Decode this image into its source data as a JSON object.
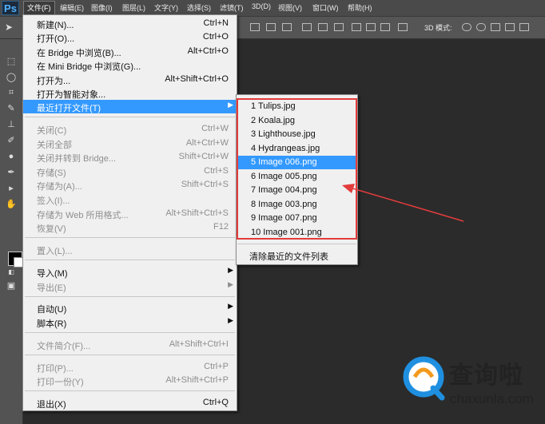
{
  "app": {
    "logo": "Ps"
  },
  "menubar": {
    "items": [
      {
        "label": "文件(F)"
      },
      {
        "label": "编辑(E)"
      },
      {
        "label": "图像(I)"
      },
      {
        "label": "图层(L)"
      },
      {
        "label": "文字(Y)"
      },
      {
        "label": "选择(S)"
      },
      {
        "label": "滤镜(T)"
      },
      {
        "label": "3D(D)"
      },
      {
        "label": "视图(V)"
      },
      {
        "label": "窗口(W)"
      },
      {
        "label": "帮助(H)"
      }
    ]
  },
  "options_bar": {
    "mode3d_label": "3D 模式:"
  },
  "file_menu": {
    "items": [
      {
        "label": "新建(N)...",
        "shortcut": "Ctrl+N"
      },
      {
        "label": "打开(O)...",
        "shortcut": "Ctrl+O"
      },
      {
        "label": "在 Bridge 中浏览(B)...",
        "shortcut": "Alt+Ctrl+O"
      },
      {
        "label": "在 Mini Bridge 中浏览(G)...",
        "shortcut": ""
      },
      {
        "label": "打开为...",
        "shortcut": "Alt+Shift+Ctrl+O"
      },
      {
        "label": "打开为智能对象...",
        "shortcut": ""
      },
      {
        "label": "最近打开文件(T)",
        "shortcut": "",
        "arrow": "▶"
      },
      {
        "label": "关闭(C)",
        "shortcut": "Ctrl+W"
      },
      {
        "label": "关闭全部",
        "shortcut": "Alt+Ctrl+W"
      },
      {
        "label": "关闭并转到 Bridge...",
        "shortcut": "Shift+Ctrl+W"
      },
      {
        "label": "存储(S)",
        "shortcut": "Ctrl+S"
      },
      {
        "label": "存储为(A)...",
        "shortcut": "Shift+Ctrl+S"
      },
      {
        "label": "签入(I)...",
        "shortcut": ""
      },
      {
        "label": "存储为 Web 所用格式...",
        "shortcut": "Alt+Shift+Ctrl+S"
      },
      {
        "label": "恢复(V)",
        "shortcut": "F12"
      },
      {
        "label": "置入(L)...",
        "shortcut": ""
      },
      {
        "label": "导入(M)",
        "shortcut": "",
        "arrow": "▶"
      },
      {
        "label": "导出(E)",
        "shortcut": "",
        "arrow": "▶"
      },
      {
        "label": "自动(U)",
        "shortcut": "",
        "arrow": "▶"
      },
      {
        "label": "脚本(R)",
        "shortcut": "",
        "arrow": "▶"
      },
      {
        "label": "文件简介(F)...",
        "shortcut": "Alt+Shift+Ctrl+I"
      },
      {
        "label": "打印(P)...",
        "shortcut": "Ctrl+P"
      },
      {
        "label": "打印一份(Y)",
        "shortcut": "Alt+Shift+Ctrl+P"
      },
      {
        "label": "退出(X)",
        "shortcut": "Ctrl+Q"
      }
    ]
  },
  "recent_files": {
    "items": [
      {
        "label": "1  Tulips.jpg"
      },
      {
        "label": "2  Koala.jpg"
      },
      {
        "label": "3  Lighthouse.jpg"
      },
      {
        "label": "4  Hydrangeas.jpg"
      },
      {
        "label": "5  Image 006.png"
      },
      {
        "label": "6  Image 005.png"
      },
      {
        "label": "7  Image 004.png"
      },
      {
        "label": "8  Image 003.png"
      },
      {
        "label": "9  Image 007.png"
      },
      {
        "label": "10  Image 001.png"
      }
    ],
    "clear_label": "清除最近的文件列表"
  },
  "watermark": {
    "text_cn": "查询啦",
    "text_en": "chaxunla.com"
  },
  "colors": {
    "highlight": "#3399ff",
    "annotation": "#e23c3c",
    "foreground": "#000000",
    "background": "#ffffff"
  },
  "icons": [
    "move-tool-icon",
    "marquee-tool-icon",
    "lasso-tool-icon",
    "crop-tool-icon",
    "eyedropper-tool-icon",
    "healing-brush-icon",
    "brush-tool-icon",
    "stamp-tool-icon",
    "history-brush-icon",
    "eraser-tool-icon",
    "gradient-tool-icon",
    "blur-tool-icon",
    "dodge-tool-icon",
    "pen-tool-icon",
    "type-tool-icon",
    "path-select-icon",
    "shape-tool-icon",
    "hand-tool-icon",
    "zoom-tool-icon"
  ]
}
